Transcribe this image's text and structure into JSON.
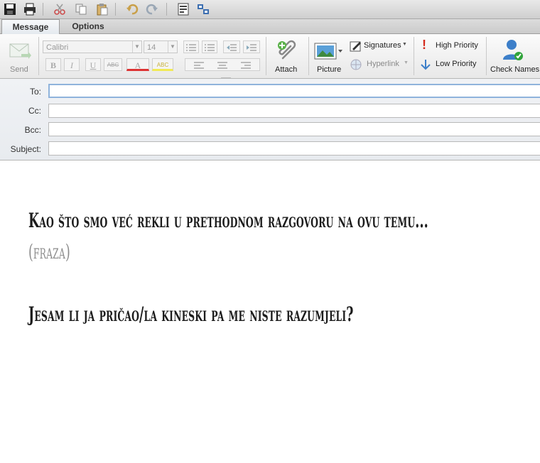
{
  "quick_access": {
    "icons": [
      "save-icon",
      "print-icon",
      "cut-icon",
      "copy-icon",
      "paste-icon",
      "undo-icon",
      "redo-icon",
      "format-icon",
      "network-icon"
    ]
  },
  "tabs": [
    {
      "label": "Message",
      "active": true
    },
    {
      "label": "Options",
      "active": false
    }
  ],
  "ribbon": {
    "send_label": "Send",
    "font_name": "Calibri",
    "font_size": "14",
    "bold": "B",
    "italic": "I",
    "underline": "U",
    "strike": "ABC",
    "font_color": "A",
    "highlight": "ABC",
    "attach_label": "Attach",
    "picture_label": "Picture",
    "signatures_label": "Signatures",
    "hyperlink_label": "Hyperlink",
    "high_priority_label": "High Priority",
    "low_priority_label": "Low Priority",
    "check_names_label": "Check Names"
  },
  "headers": {
    "to_label": "To:",
    "cc_label": "Cc:",
    "bcc_label": "Bcc:",
    "subject_label": "Subject:",
    "to_value": "",
    "cc_value": "",
    "bcc_value": "",
    "subject_value": ""
  },
  "body": {
    "line1": "Kao što smo već rekli u prethodnom razgovoru na ovu temu...",
    "line2": "(fraza)",
    "line3": "Jesam li ja pričao/la kineski pa me niste razumjeli?"
  },
  "colors": {
    "accent_blue": "#3d7fc9",
    "priority_red": "#d42b1e",
    "check_green": "#2fa33a",
    "body_text": "#1c1c1c",
    "phrase_gray": "#8c8c8c"
  }
}
